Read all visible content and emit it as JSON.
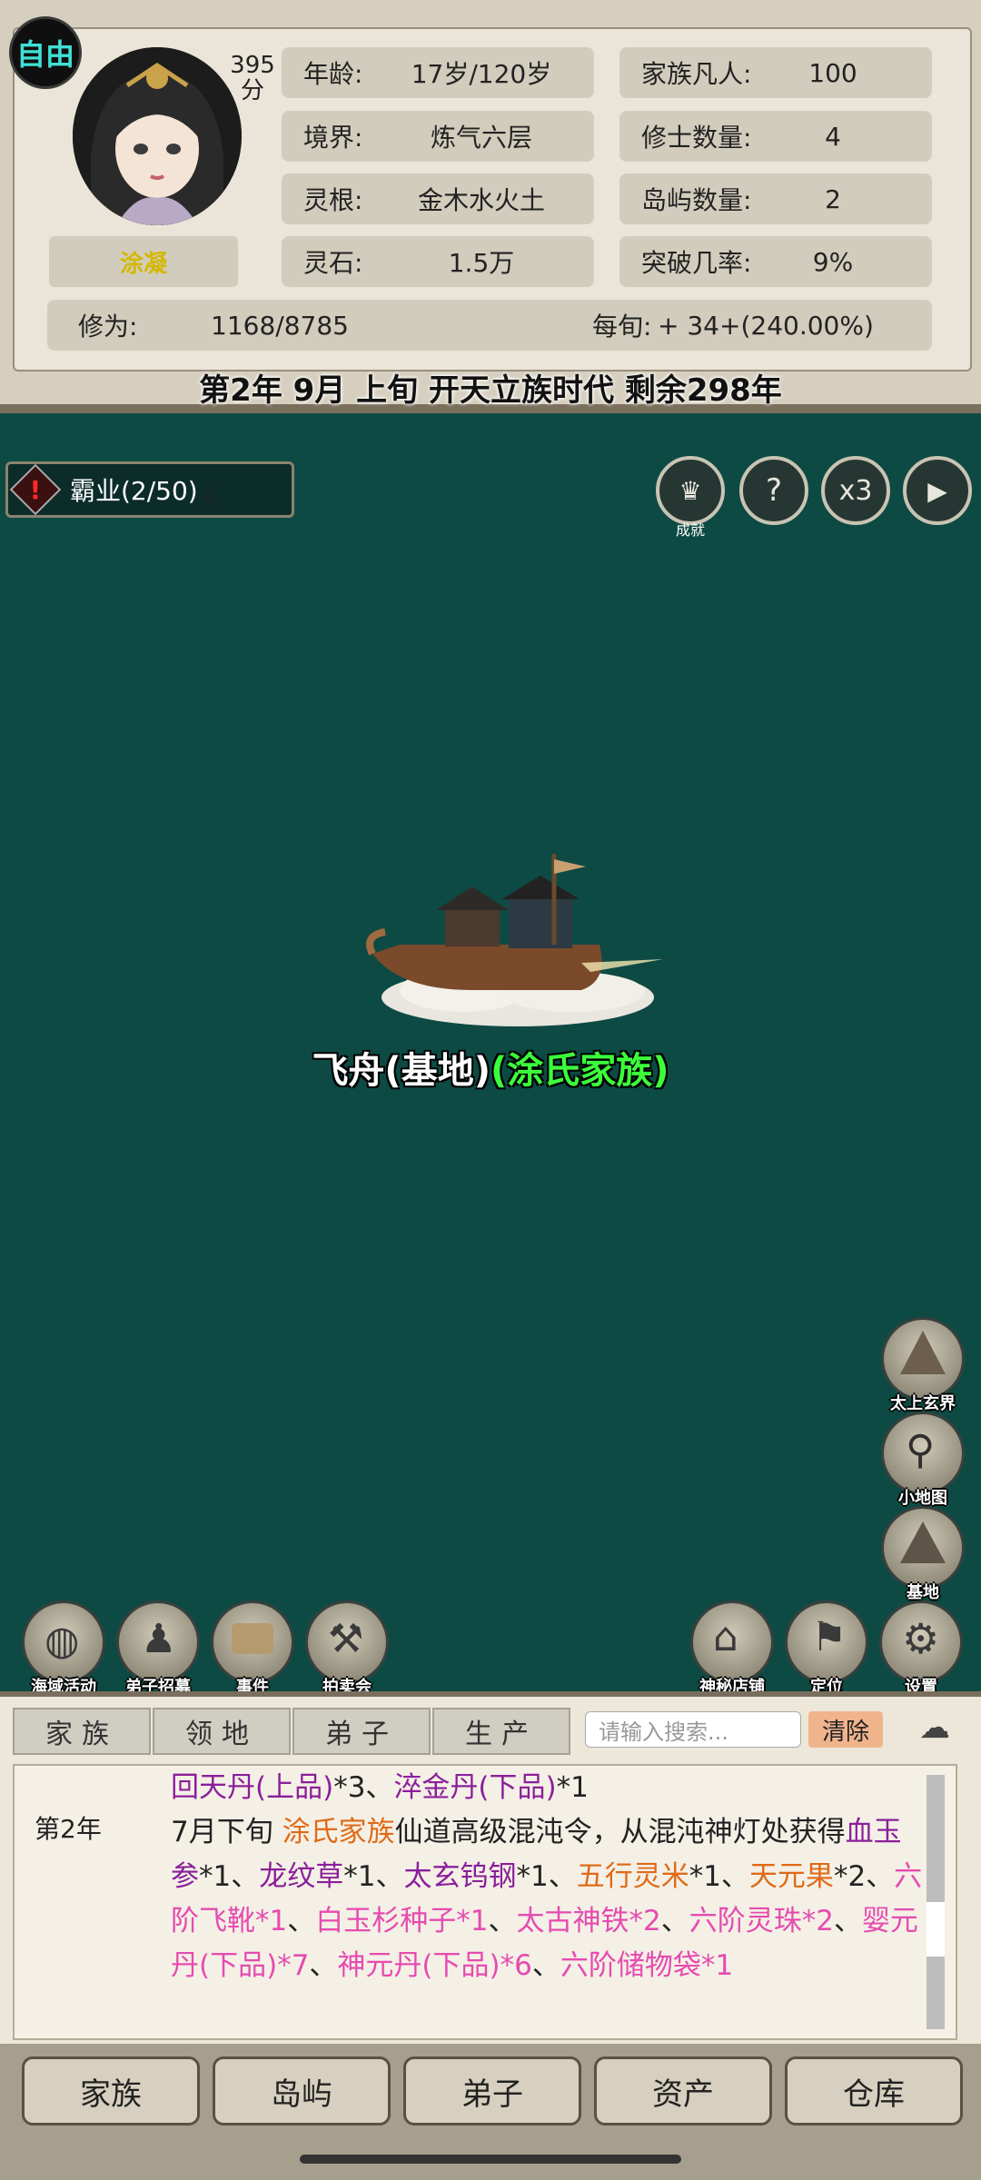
{
  "header": {
    "free_label": "自由",
    "score": "395",
    "score_unit": "分",
    "character_name": "涂凝",
    "stats_left": [
      {
        "label": "年龄:",
        "value": "17岁/120岁"
      },
      {
        "label": "境界:",
        "value": "炼气六层"
      },
      {
        "label": "灵根:",
        "value": "金木水火土"
      },
      {
        "label": "灵石:",
        "value": "1.5万"
      }
    ],
    "stats_right": [
      {
        "label": "家族凡人:",
        "value": "100"
      },
      {
        "label": "修士数量:",
        "value": "4"
      },
      {
        "label": "岛屿数量:",
        "value": "2"
      },
      {
        "label": "突破几率:",
        "value": "9%"
      }
    ],
    "cultivation_label": "修为:",
    "cultivation_value": "1168/8785",
    "per_period_label": "每旬:",
    "per_period_value": "+ 34+(240.00%)",
    "date_line": "第2年 9月 上旬  开天立族时代 剩余298年"
  },
  "map": {
    "quest_label": "霸业(2/50)",
    "top_buttons": [
      {
        "name": "achievement-button",
        "label": "成就"
      },
      {
        "name": "help-button",
        "label": "?"
      },
      {
        "name": "speed-button",
        "label": "x3"
      },
      {
        "name": "play-button",
        "label": "▶"
      }
    ],
    "ship_label_main": "飞舟(基地)",
    "ship_label_family": "(涂氏家族)",
    "side_buttons": [
      "太上玄界",
      "小地图",
      "基地"
    ],
    "bottom_left_buttons": [
      "海域活动",
      "弟子招募",
      "事件",
      "拍卖会"
    ],
    "bottom_right_buttons": [
      "神秘店铺",
      "定位",
      "设置"
    ]
  },
  "log": {
    "tabs": [
      "家族",
      "领地",
      "弟子",
      "生产"
    ],
    "search_placeholder": "请输入搜索...",
    "clear_label": "清除",
    "year": "第2年",
    "colors": {
      "purple": "#8b1f9a",
      "orange": "#e06a18",
      "pink": "#e64bb0"
    }
  },
  "bottom_nav": [
    "家族",
    "岛屿",
    "弟子",
    "资产",
    "仓库"
  ]
}
